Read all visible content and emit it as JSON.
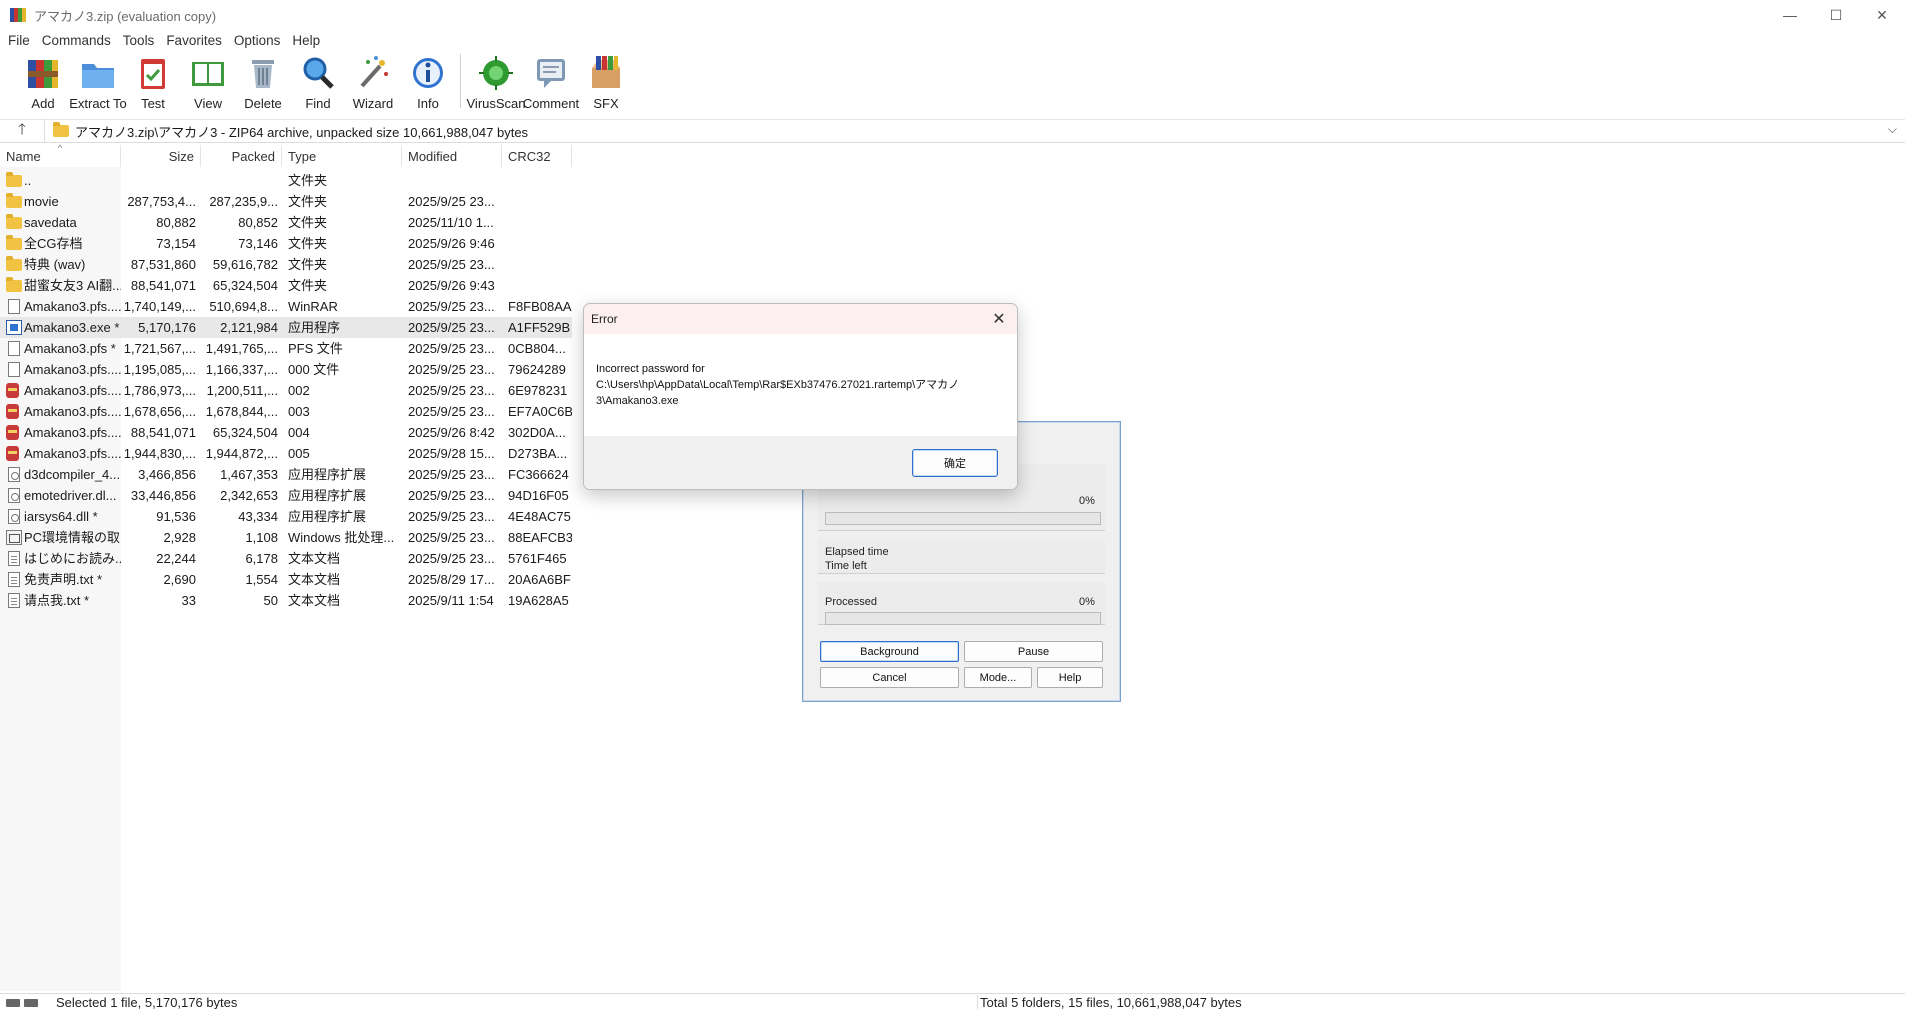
{
  "window": {
    "title": "アマカノ3.zip (evaluation copy)",
    "controls": {
      "minimize": "—",
      "maximize": "☐",
      "close": "✕"
    }
  },
  "menu": [
    "File",
    "Commands",
    "Tools",
    "Favorites",
    "Options",
    "Help"
  ],
  "toolbar": [
    {
      "label": "Add",
      "icon": "add-archive-icon"
    },
    {
      "label": "Extract To",
      "icon": "extract-folder-icon"
    },
    {
      "label": "Test",
      "icon": "test-clipboard-icon"
    },
    {
      "label": "View",
      "icon": "view-book-icon"
    },
    {
      "label": "Delete",
      "icon": "trash-icon"
    },
    {
      "label": "Find",
      "icon": "magnifier-icon"
    },
    {
      "label": "Wizard",
      "icon": "magic-wand-icon"
    },
    {
      "label": "Info",
      "icon": "info-icon"
    },
    {
      "label": "VirusScan",
      "icon": "virus-scan-icon"
    },
    {
      "label": "Comment",
      "icon": "comment-icon"
    },
    {
      "label": "SFX",
      "icon": "sfx-box-icon"
    }
  ],
  "address": {
    "up": "🡑",
    "path": "アマカノ3.zip\\アマカノ3 - ZIP64 archive, unpacked size 10,661,988,047 bytes",
    "chevron": "⌵"
  },
  "columns": {
    "name": "Name",
    "size": "Size",
    "packed": "Packed",
    "type": "Type",
    "modified": "Modified",
    "crc": "CRC32",
    "sort_arrow": "^"
  },
  "files": [
    {
      "icon": "folder",
      "name": "..",
      "size": "",
      "packed": "",
      "type": "文件夹",
      "modified": "",
      "crc": ""
    },
    {
      "icon": "folder",
      "name": "movie",
      "size": "287,753,4...",
      "packed": "287,235,9...",
      "type": "文件夹",
      "modified": "2025/9/25 23...",
      "crc": ""
    },
    {
      "icon": "folder",
      "name": "savedata",
      "size": "80,882",
      "packed": "80,852",
      "type": "文件夹",
      "modified": "2025/11/10 1...",
      "crc": ""
    },
    {
      "icon": "folder",
      "name": "全CG存档",
      "size": "73,154",
      "packed": "73,146",
      "type": "文件夹",
      "modified": "2025/9/26 9:46",
      "crc": ""
    },
    {
      "icon": "folder",
      "name": "特典 (wav)",
      "size": "87,531,860",
      "packed": "59,616,782",
      "type": "文件夹",
      "modified": "2025/9/25 23...",
      "crc": ""
    },
    {
      "icon": "folder",
      "name": "甜蜜女友3 AI翻...",
      "size": "88,541,071",
      "packed": "65,324,504",
      "type": "文件夹",
      "modified": "2025/9/26 9:43",
      "crc": ""
    },
    {
      "icon": "file",
      "name": "Amakano3.pfs....",
      "size": "1,740,149,...",
      "packed": "510,694,8...",
      "type": "WinRAR",
      "modified": "2025/9/25 23...",
      "crc": "F8FB08AA"
    },
    {
      "icon": "exe",
      "name": "Amakano3.exe *",
      "size": "5,170,176",
      "packed": "2,121,984",
      "type": "应用程序",
      "modified": "2025/9/25 23...",
      "crc": "A1FF529B",
      "selected": true
    },
    {
      "icon": "file",
      "name": "Amakano3.pfs *",
      "size": "1,721,567,...",
      "packed": "1,491,765,...",
      "type": "PFS 文件",
      "modified": "2025/9/25 23...",
      "crc": "0CB804..."
    },
    {
      "icon": "file",
      "name": "Amakano3.pfs....",
      "size": "1,195,085,...",
      "packed": "1,166,337,...",
      "type": "000 文件",
      "modified": "2025/9/25 23...",
      "crc": "79624289"
    },
    {
      "icon": "rar",
      "name": "Amakano3.pfs....",
      "size": "1,786,973,...",
      "packed": "1,200,511,...",
      "type": "002",
      "modified": "2025/9/25 23...",
      "crc": "6E978231"
    },
    {
      "icon": "rar",
      "name": "Amakano3.pfs....",
      "size": "1,678,656,...",
      "packed": "1,678,844,...",
      "type": "003",
      "modified": "2025/9/25 23...",
      "crc": "EF7A0C6B"
    },
    {
      "icon": "rar",
      "name": "Amakano3.pfs....",
      "size": "88,541,071",
      "packed": "65,324,504",
      "type": "004",
      "modified": "2025/9/26 8:42",
      "crc": "302D0A..."
    },
    {
      "icon": "rar",
      "name": "Amakano3.pfs....",
      "size": "1,944,830,...",
      "packed": "1,944,872,...",
      "type": "005",
      "modified": "2025/9/28 15...",
      "crc": "D273BA..."
    },
    {
      "icon": "dll",
      "name": "d3dcompiler_4...",
      "size": "3,466,856",
      "packed": "1,467,353",
      "type": "应用程序扩展",
      "modified": "2025/9/25 23...",
      "crc": "FC366624"
    },
    {
      "icon": "dll",
      "name": "emotedriver.dl...",
      "size": "33,446,856",
      "packed": "2,342,653",
      "type": "应用程序扩展",
      "modified": "2025/9/25 23...",
      "crc": "94D16F05"
    },
    {
      "icon": "dll",
      "name": "iarsys64.dll *",
      "size": "91,536",
      "packed": "43,334",
      "type": "应用程序扩展",
      "modified": "2025/9/25 23...",
      "crc": "4E48AC75"
    },
    {
      "icon": "bat",
      "name": "PC環境情報の取...",
      "size": "2,928",
      "packed": "1,108",
      "type": "Windows 批处理...",
      "modified": "2025/9/25 23...",
      "crc": "88EAFCB3"
    },
    {
      "icon": "txt",
      "name": "はじめにお読み...",
      "size": "22,244",
      "packed": "6,178",
      "type": "文本文档",
      "modified": "2025/9/25 23...",
      "crc": "5761F465"
    },
    {
      "icon": "txt",
      "name": "免责声明.txt *",
      "size": "2,690",
      "packed": "1,554",
      "type": "文本文档",
      "modified": "2025/8/29 17...",
      "crc": "20A6A6BF"
    },
    {
      "icon": "txt",
      "name": "请点我.txt *",
      "size": "33",
      "packed": "50",
      "type": "文本文档",
      "modified": "2025/9/11 1:54",
      "crc": "19A628A5"
    }
  ],
  "status": {
    "left": "Selected 1 file, 5,170,176 bytes",
    "right": "Total 5 folders, 15 files, 10,661,988,047 bytes"
  },
  "progress": {
    "top_percent": "0%",
    "top_fill": 0,
    "elapsed_label": "Elapsed time",
    "left_label": "Time left",
    "processed_label": "Processed",
    "processed_percent": "0%",
    "processed_fill": 0,
    "buttons": {
      "background": "Background",
      "pause": "Pause",
      "cancel": "Cancel",
      "mode": "Mode...",
      "help": "Help"
    }
  },
  "error": {
    "title": "Error",
    "close": "✕",
    "line1": "Incorrect password for",
    "line2": "C:\\Users\\hp\\AppData\\Local\\Temp\\Rar$EXb37476.27021.rartemp\\アマカノ",
    "line3": "3\\Amakano3.exe",
    "ok": "确定"
  }
}
